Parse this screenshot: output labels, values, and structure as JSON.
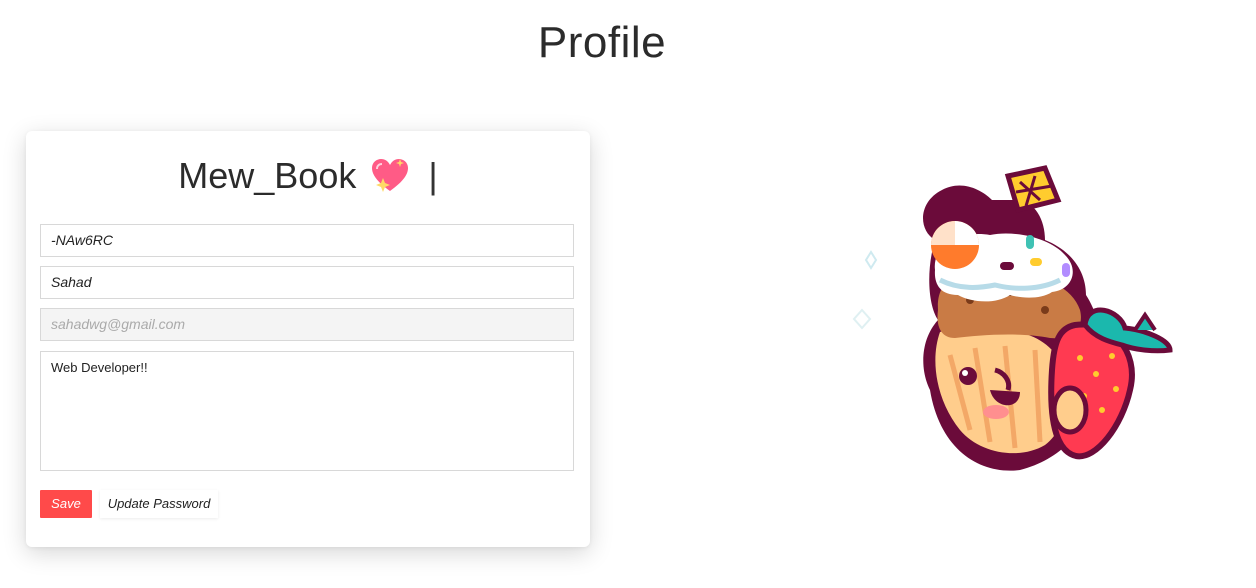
{
  "page": {
    "title": "Profile"
  },
  "profile_card": {
    "username": "Mew_Book",
    "cursor_char": "|",
    "fields": {
      "id_value": "-NAw6RC",
      "name_value": "Sahad",
      "email_value": "sahadwg@gmail.com",
      "bio_value": "Web Developer!!"
    },
    "buttons": {
      "save_label": "Save",
      "update_password_label": "Update Password"
    }
  },
  "colors": {
    "accent": "#ff4a4a",
    "heart": "#ff4f7b"
  },
  "icons": {
    "title_emoji": "sparkling-heart-icon",
    "illustration": "cupcake-strawberry-illustration"
  }
}
